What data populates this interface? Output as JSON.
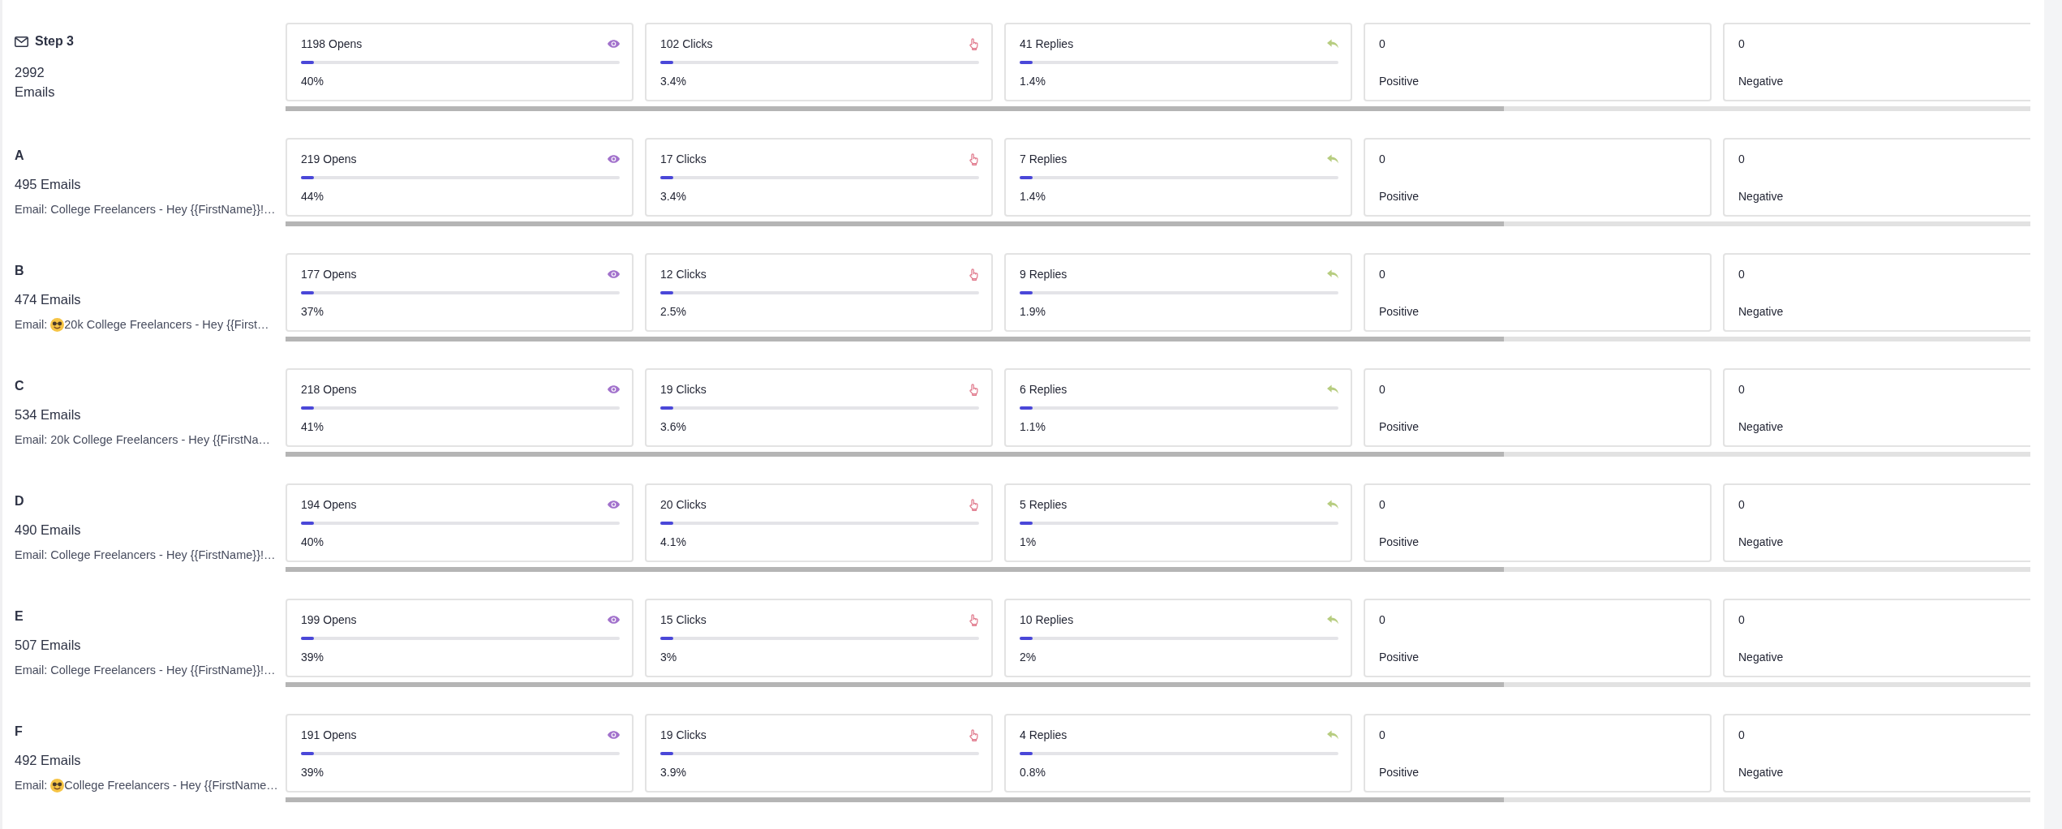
{
  "rows": [
    {
      "kind": "step",
      "title": "Step 3",
      "count": "2992 Emails",
      "cards": [
        {
          "kind": "opens",
          "value": "1198 Opens",
          "level": 0.04,
          "rate": "40%"
        },
        {
          "kind": "clicks",
          "value": "102 Clicks",
          "level": 0.04,
          "rate": "3.4%"
        },
        {
          "kind": "replies",
          "value": "41 Replies",
          "level": 0.04,
          "rate": "1.4%"
        },
        {
          "kind": "positive",
          "value": "0",
          "label": "Positive"
        },
        {
          "kind": "negative",
          "value": "0",
          "label": "Negative"
        }
      ]
    },
    {
      "kind": "variant",
      "label": "A",
      "count": "495 Emails",
      "subject": {
        "prefix": "Email:",
        "emoji": false,
        "text": "College Freelancers - Hey {{FirstName}}!…"
      },
      "cards": [
        {
          "kind": "opens",
          "value": "219 Opens",
          "level": 0.04,
          "rate": "44%"
        },
        {
          "kind": "clicks",
          "value": "17 Clicks",
          "level": 0.04,
          "rate": "3.4%"
        },
        {
          "kind": "replies",
          "value": "7 Replies",
          "level": 0.04,
          "rate": "1.4%"
        },
        {
          "kind": "positive",
          "value": "0",
          "label": "Positive"
        },
        {
          "kind": "negative",
          "value": "0",
          "label": "Negative"
        }
      ]
    },
    {
      "kind": "variant",
      "label": "B",
      "count": "474 Emails",
      "subject": {
        "prefix": "Email:",
        "emoji": true,
        "text": "20k College Freelancers - Hey {{First…"
      },
      "cards": [
        {
          "kind": "opens",
          "value": "177 Opens",
          "level": 0.04,
          "rate": "37%"
        },
        {
          "kind": "clicks",
          "value": "12 Clicks",
          "level": 0.04,
          "rate": "2.5%"
        },
        {
          "kind": "replies",
          "value": "9 Replies",
          "level": 0.04,
          "rate": "1.9%"
        },
        {
          "kind": "positive",
          "value": "0",
          "label": "Positive"
        },
        {
          "kind": "negative",
          "value": "0",
          "label": "Negative"
        }
      ]
    },
    {
      "kind": "variant",
      "label": "C",
      "count": "534 Emails",
      "subject": {
        "prefix": "Email:",
        "emoji": false,
        "text": "20k College Freelancers - Hey {{FirstNa…"
      },
      "cards": [
        {
          "kind": "opens",
          "value": "218 Opens",
          "level": 0.04,
          "rate": "41%"
        },
        {
          "kind": "clicks",
          "value": "19 Clicks",
          "level": 0.04,
          "rate": "3.6%"
        },
        {
          "kind": "replies",
          "value": "6 Replies",
          "level": 0.04,
          "rate": "1.1%"
        },
        {
          "kind": "positive",
          "value": "0",
          "label": "Positive"
        },
        {
          "kind": "negative",
          "value": "0",
          "label": "Negative"
        }
      ]
    },
    {
      "kind": "variant",
      "label": "D",
      "count": "490 Emails",
      "subject": {
        "prefix": "Email:",
        "emoji": false,
        "text": "College Freelancers - Hey {{FirstName}}!…"
      },
      "cards": [
        {
          "kind": "opens",
          "value": "194 Opens",
          "level": 0.04,
          "rate": "40%"
        },
        {
          "kind": "clicks",
          "value": "20 Clicks",
          "level": 0.04,
          "rate": "4.1%"
        },
        {
          "kind": "replies",
          "value": "5 Replies",
          "level": 0.04,
          "rate": "1%"
        },
        {
          "kind": "positive",
          "value": "0",
          "label": "Positive"
        },
        {
          "kind": "negative",
          "value": "0",
          "label": "Negative"
        }
      ]
    },
    {
      "kind": "variant",
      "label": "E",
      "count": "507 Emails",
      "subject": {
        "prefix": "Email:",
        "emoji": false,
        "text": "College Freelancers - Hey {{FirstName}}!…"
      },
      "cards": [
        {
          "kind": "opens",
          "value": "199 Opens",
          "level": 0.04,
          "rate": "39%"
        },
        {
          "kind": "clicks",
          "value": "15 Clicks",
          "level": 0.04,
          "rate": "3%"
        },
        {
          "kind": "replies",
          "value": "10 Replies",
          "level": 0.04,
          "rate": "2%"
        },
        {
          "kind": "positive",
          "value": "0",
          "label": "Positive"
        },
        {
          "kind": "negative",
          "value": "0",
          "label": "Negative"
        }
      ]
    },
    {
      "kind": "variant",
      "label": "F",
      "count": "492 Emails",
      "subject": {
        "prefix": "Email:",
        "emoji": true,
        "text": "College Freelancers - Hey {{FirstName…"
      },
      "cards": [
        {
          "kind": "opens",
          "value": "191 Opens",
          "level": 0.04,
          "rate": "39%"
        },
        {
          "kind": "clicks",
          "value": "19 Clicks",
          "level": 0.04,
          "rate": "3.9%"
        },
        {
          "kind": "replies",
          "value": "4 Replies",
          "level": 0.04,
          "rate": "0.8%"
        },
        {
          "kind": "positive",
          "value": "0",
          "label": "Positive"
        },
        {
          "kind": "negative",
          "value": "0",
          "label": "Negative"
        }
      ]
    }
  ]
}
